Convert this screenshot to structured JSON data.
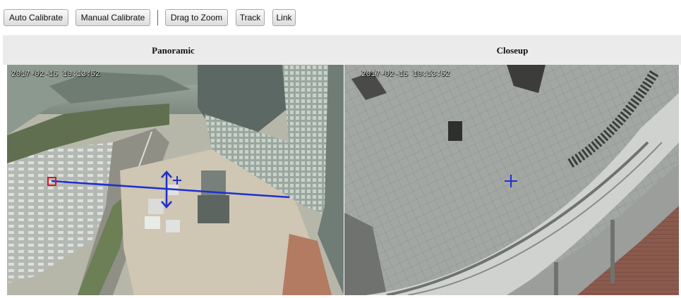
{
  "toolbar": {
    "auto_calibrate": "Auto Calibrate",
    "manual_calibrate": "Manual Calibrate",
    "drag_to_zoom": "Drag to Zoom",
    "track": "Track",
    "link": "Link"
  },
  "panels": {
    "panoramic": {
      "title": "Panoramic",
      "timestamp": "2017-02-15 10:13:52"
    },
    "closeup": {
      "title": "Closeup",
      "timestamp": "2017-02-15 10:13:52"
    }
  },
  "colors": {
    "calibration_line": "#1f2ed1",
    "marker": "#d81b1b",
    "crosshair": "#1f2ed1"
  }
}
